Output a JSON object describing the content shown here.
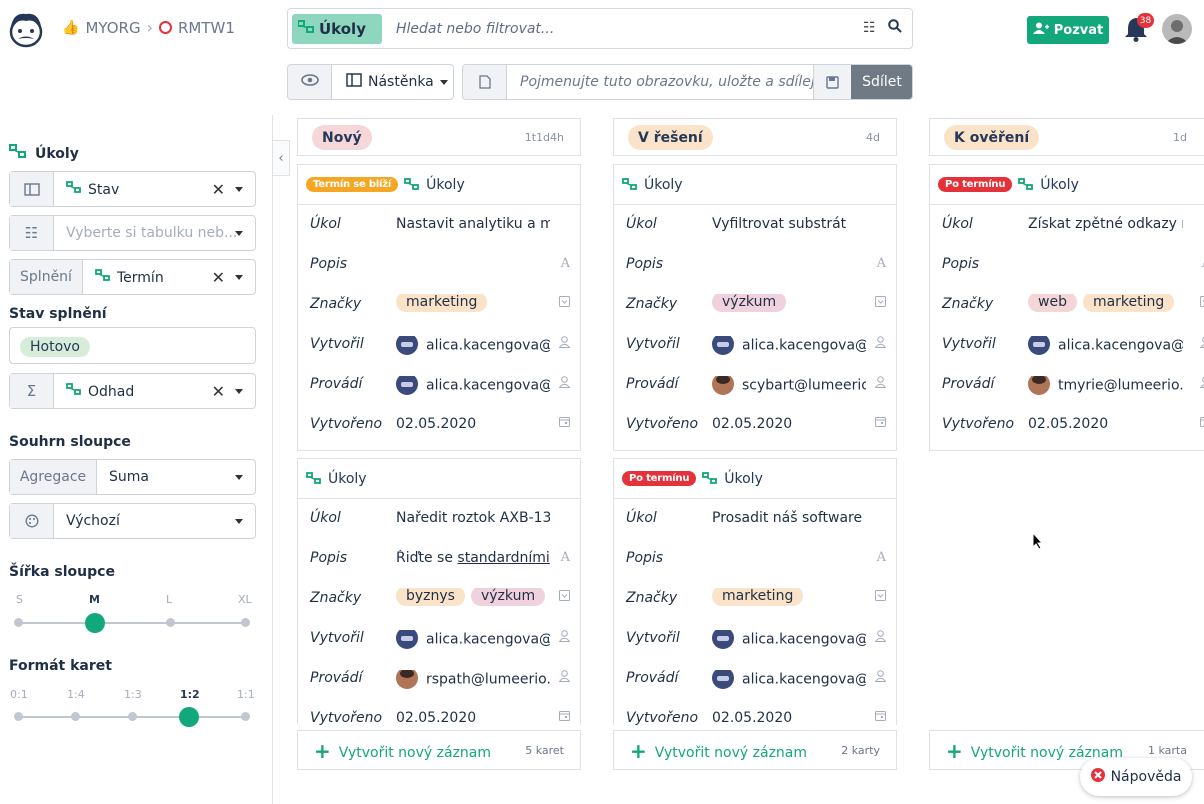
{
  "breadcrumb": {
    "org": "MYORG",
    "project": "RMTW1"
  },
  "search": {
    "chip_label": "Úkoly",
    "placeholder": "Hledat nebo filtrovat..."
  },
  "invite": {
    "label": "Pozvat"
  },
  "notifications": {
    "count": "38"
  },
  "toolbar": {
    "view_label": "Nástěnka",
    "name_placeholder": "Pojmenujte tuto obrazovku, uložte a sdílejte!",
    "share_label": "Sdílet"
  },
  "sidebar": {
    "collection_title": "Úkoly",
    "group_by": {
      "value": "Stav"
    },
    "sort_placeholder": "Vyberte si tabulku neb...",
    "due": {
      "prefix": "Splnění",
      "value": "Termín"
    },
    "done_state_title": "Stav splnění",
    "done_state_value": "Hotovo",
    "sum_field": {
      "value": "Odhad"
    },
    "column_summary_title": "Souhrn sloupce",
    "aggregation": {
      "prefix": "Agregace",
      "value": "Suma"
    },
    "default_select": "Výchozí",
    "width_title": "Šířka sloupce",
    "width_options": [
      "S",
      "M",
      "L",
      "XL"
    ],
    "width_selected": "M",
    "format_title": "Formát karet",
    "format_options": [
      "0:1",
      "1:4",
      "1:3",
      "1:2",
      "1:1"
    ],
    "format_selected": "1:2"
  },
  "labels": {
    "ukol": "Úkol",
    "popis": "Popis",
    "znacky": "Značky",
    "vytvoril": "Vytvořil",
    "provadi": "Provádí",
    "vytvoreno": "Vytvořeno",
    "collection": "Úkoly",
    "new_record": "Vytvořit nový záznam"
  },
  "columns": [
    {
      "state": "Nový",
      "age": "1t1d4h",
      "count": "5 karet",
      "cards": [
        {
          "pill": "Termín se blíží",
          "task": "Nastavit analytiku a moni",
          "desc": "",
          "tags": [
            "marketing"
          ],
          "creator": "alica.kacengova@",
          "assignee": "alica.kacengova@",
          "created": "02.05.2020"
        },
        {
          "pill": "",
          "task": "Naředit roztok AXB-13",
          "desc_prefix": "Řiďte se ",
          "desc": "standardními",
          "tags": [
            "byznys",
            "výzkum"
          ],
          "creator": "alica.kacengova@",
          "assignee": "rspath@lumeerio.",
          "created": "02.05.2020"
        }
      ]
    },
    {
      "state": "V řešení",
      "age": "4d",
      "count": "2 karty",
      "cards": [
        {
          "pill": "",
          "task": "Vyfiltrovat substrát",
          "desc": "",
          "tags": [
            "výzkum"
          ],
          "creator": "alica.kacengova@",
          "assignee": "scybart@lumeerio",
          "created": "02.05.2020"
        },
        {
          "pill": "Po termínu",
          "task": "Prosadit náš software pr",
          "desc": "",
          "tags": [
            "marketing"
          ],
          "creator": "alica.kacengova@",
          "assignee": "alica.kacengova@",
          "created": "02.05.2020"
        }
      ]
    },
    {
      "state": "K ověření",
      "age": "1d",
      "count": "1 karta",
      "cards": [
        {
          "pill": "Po termínu",
          "task": "Získat zpětné odkazy na",
          "desc": "",
          "tags": [
            "web",
            "marketing"
          ],
          "creator": "alica.kacengova@",
          "assignee": "tmyrie@lumeerio.",
          "created": "02.05.2020"
        }
      ]
    }
  ],
  "help": {
    "label": "Nápověda"
  },
  "colors": {
    "accent": "#13a77c",
    "overdue": "#e5323a",
    "due_soon": "#f5a623"
  }
}
